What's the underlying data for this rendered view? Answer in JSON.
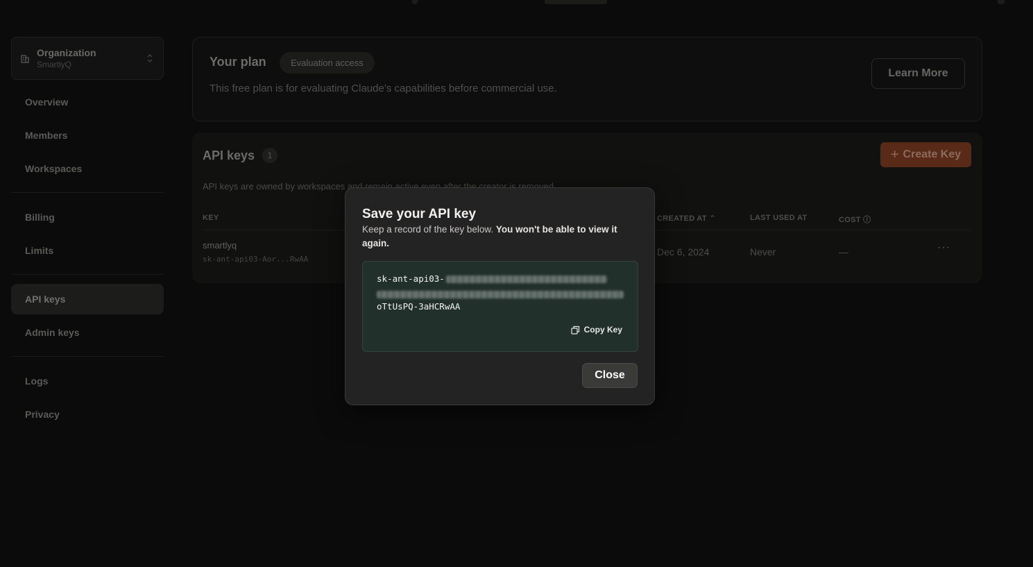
{
  "sidebar": {
    "org": {
      "name": "Organization",
      "sub": "SmartlyQ"
    },
    "items": [
      {
        "label": "Overview"
      },
      {
        "label": "Members"
      },
      {
        "label": "Workspaces"
      },
      {
        "label": "Billing"
      },
      {
        "label": "Limits"
      },
      {
        "label": "API keys",
        "active": true
      },
      {
        "label": "Admin keys"
      },
      {
        "label": "Logs"
      },
      {
        "label": "Privacy"
      }
    ]
  },
  "plan": {
    "title": "Your plan",
    "badge": "Evaluation access",
    "description": "This free plan is for evaluating Claude’s capabilities before commercial use.",
    "learn_more": "Learn More"
  },
  "api_keys": {
    "title": "API keys",
    "count": "1",
    "create_label": "Create Key",
    "description": "API keys are owned by workspaces and remain active even after the creator is removed.",
    "columns": {
      "key": "KEY",
      "created_at": "CREATED AT",
      "last_used_at": "LAST USED AT",
      "cost": "COST"
    },
    "rows": [
      {
        "name": "smartlyq",
        "key": "sk-ant-api03-Aor...RwAA",
        "created_at": "Dec 6, 2024",
        "last_used_at": "Never",
        "cost": "—"
      }
    ]
  },
  "modal": {
    "title": "Save your API key",
    "desc_plain": "Keep a record of the key below. ",
    "desc_bold": "You won't be able to view it again.",
    "key_prefix": "sk-ant-api03-",
    "key_suffix": "oTtUsPQ-3aHCRwAA",
    "copy_label": "Copy Key",
    "close_label": "Close"
  },
  "colors": {
    "accent": "#5a2a18",
    "key_box": "#22302b",
    "modal_bg": "#232323"
  }
}
